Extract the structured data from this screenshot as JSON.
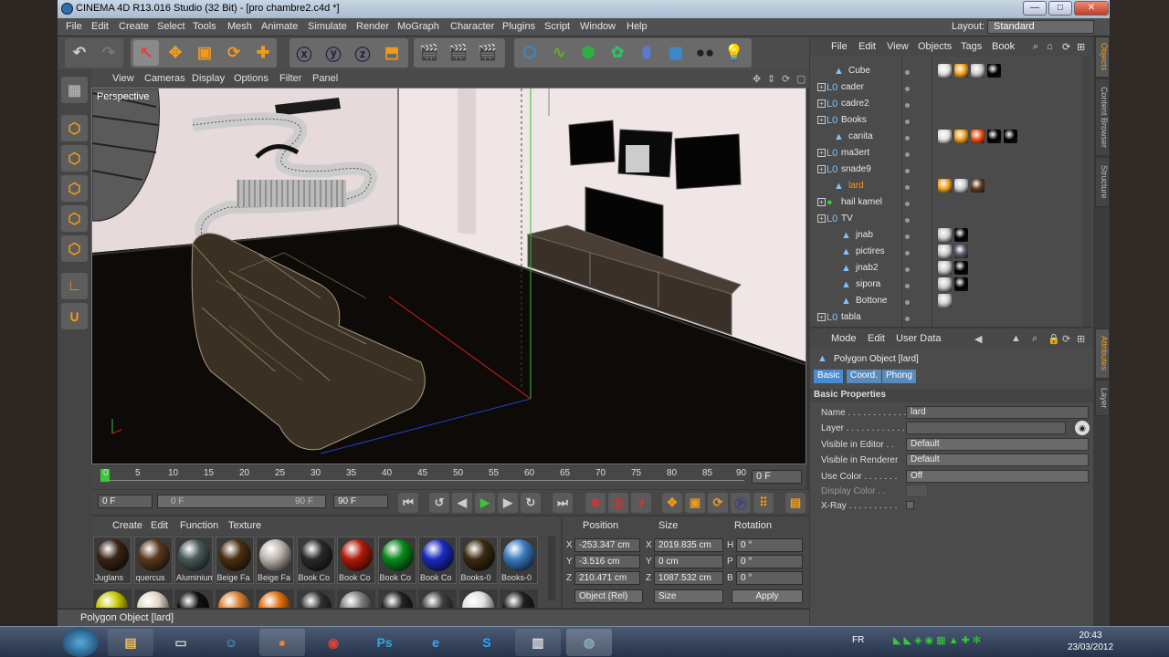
{
  "window": {
    "title": "CINEMA 4D R13.016 Studio (32 Bit) - [pro chambre2.c4d *]",
    "min": "—",
    "max": "□",
    "close": "✕"
  },
  "menubar": {
    "items": [
      "File",
      "Edit",
      "Create",
      "Select",
      "Tools",
      "Mesh",
      "Animate",
      "Simulate",
      "Render",
      "MoGraph",
      "Character",
      "Plugins",
      "Script",
      "Window",
      "Help"
    ],
    "layout_label": "Layout:",
    "layout_value": "Standard"
  },
  "viewport": {
    "menus": [
      "View",
      "Cameras",
      "Display",
      "Options",
      "Filter",
      "Panel"
    ],
    "label": "Perspective"
  },
  "timeline": {
    "ticks": [
      "0",
      "5",
      "10",
      "15",
      "20",
      "25",
      "30",
      "35",
      "40",
      "45",
      "50",
      "55",
      "60",
      "65",
      "70",
      "75",
      "80",
      "85",
      "90"
    ],
    "current_frame": "0 F",
    "start": "0 F",
    "range_start": "0 F",
    "range_end": "90 F",
    "end": "90 F"
  },
  "material_manager": {
    "menus": [
      "Create",
      "Edit",
      "Function",
      "Texture"
    ],
    "materials": [
      {
        "name": "Juglans",
        "color": "#3a2416"
      },
      {
        "name": "quercus",
        "color": "#5a3a1e"
      },
      {
        "name": "Aluminium",
        "color": "#4a5a5a"
      },
      {
        "name": "Beige Fa",
        "color": "#4a3010"
      },
      {
        "name": "Beige Fa",
        "color": "#c0b8b0"
      },
      {
        "name": "Book Co",
        "color": "#2a2a2a"
      },
      {
        "name": "Book Co",
        "color": "#b01a0a"
      },
      {
        "name": "Book Co",
        "color": "#0a8a1a"
      },
      {
        "name": "Book Co",
        "color": "#1a2ac0"
      },
      {
        "name": "Books-0",
        "color": "#3a2a10"
      },
      {
        "name": "Books-0",
        "color": "#3a7ac0"
      }
    ],
    "row2_colors": [
      "#c8c800",
      "#e0d8c8",
      "#101010",
      "#d88030",
      "#e07010",
      "#303030",
      "#808080",
      "#202020",
      "#404040",
      "#e0e0e0",
      "#202020"
    ]
  },
  "coordinates": {
    "headers": [
      "Position",
      "Size",
      "Rotation"
    ],
    "rows": [
      {
        "axis": "X",
        "pos": "-253.347 cm",
        "saxis": "X",
        "size": "2019.835 cm",
        "raxis": "H",
        "rot": "0 °"
      },
      {
        "axis": "Y",
        "pos": "-3.516 cm",
        "saxis": "Y",
        "size": "0 cm",
        "raxis": "P",
        "rot": "0 °"
      },
      {
        "axis": "Z",
        "pos": "210.471 cm",
        "saxis": "Z",
        "size": "1087.532 cm",
        "raxis": "B",
        "rot": "0 °"
      }
    ],
    "mode": "Object (Rel)",
    "size_mode": "Size",
    "apply": "Apply"
  },
  "status": "Polygon Object [lard]",
  "object_manager": {
    "menus": [
      "File",
      "Edit",
      "View",
      "Objects",
      "Tags",
      "Book"
    ],
    "objects": [
      {
        "name": "Cube",
        "indent": 1,
        "type": "poly",
        "tags": [
          "#e0e0e0",
          "#f0a020",
          "#ccc",
          "#000"
        ],
        "selected": false
      },
      {
        "name": "cader",
        "indent": 0,
        "type": "null",
        "tags": [],
        "selected": false
      },
      {
        "name": "cadre2",
        "indent": 0,
        "type": "null",
        "tags": [],
        "selected": false
      },
      {
        "name": "Books",
        "indent": 0,
        "type": "null",
        "tags": [],
        "selected": false
      },
      {
        "name": "canita",
        "indent": 1,
        "type": "poly",
        "tags": [
          "#e0e0e0",
          "#f0a020",
          "#f05010",
          "#000",
          "#000"
        ],
        "selected": false
      },
      {
        "name": "ma3ert",
        "indent": 0,
        "type": "null",
        "tags": [],
        "selected": false
      },
      {
        "name": "snade9",
        "indent": 0,
        "type": "null",
        "tags": [],
        "selected": false
      },
      {
        "name": "lard",
        "indent": 1,
        "type": "poly",
        "tags": [
          "#f0a020",
          "#ccc",
          "#5a3a1e"
        ],
        "selected": true
      },
      {
        "name": "hail kamel",
        "indent": 0,
        "type": "sphere",
        "tags": [],
        "selected": false
      },
      {
        "name": "TV",
        "indent": 0,
        "type": "null",
        "tags": [],
        "selected": false
      },
      {
        "name": "jnab",
        "indent": 2,
        "type": "poly",
        "tags": [
          "#ccc",
          "#000"
        ],
        "selected": false
      },
      {
        "name": "pictires",
        "indent": 2,
        "type": "poly",
        "tags": [
          "#ccc",
          "#556"
        ],
        "selected": false
      },
      {
        "name": "jnab2",
        "indent": 2,
        "type": "poly",
        "tags": [
          "#ccc",
          "#000"
        ],
        "selected": false
      },
      {
        "name": "sipora",
        "indent": 2,
        "type": "poly",
        "tags": [
          "#ccc",
          "#000"
        ],
        "selected": false
      },
      {
        "name": "Bottone",
        "indent": 2,
        "type": "poly",
        "tags": [
          "#ccc"
        ],
        "selected": false
      },
      {
        "name": "tabla",
        "indent": 0,
        "type": "null",
        "tags": [],
        "selected": false
      }
    ]
  },
  "attributes": {
    "menus": [
      "Mode",
      "Edit",
      "User Data"
    ],
    "object_title": "Polygon Object [lard]",
    "tabs": [
      "Basic",
      "Coord.",
      "Phong"
    ],
    "section": "Basic Properties",
    "name_label": "Name . . . . . . . . . . . . . . .",
    "name_value": "lard",
    "layer_label": "Layer . . . . . . . . . . . . . . .",
    "layer_value": "",
    "vis_editor_label": "Visible in Editor . .",
    "vis_editor_value": "Default",
    "vis_render_label": "Visible in Renderer",
    "vis_render_value": "Default",
    "use_color_label": "Use Color . . . . . . .",
    "use_color_value": "Off",
    "display_color_label": "Display Color . .",
    "xray_label": "X-Ray . . . . . . . . . ."
  },
  "side_tabs_top": [
    "Objects",
    "Content Browser",
    "Structure"
  ],
  "side_tabs_bottom": [
    "Attributes",
    "Layer"
  ],
  "taskbar": {
    "lang": "FR",
    "time": "20:43",
    "date": "23/03/2012"
  }
}
